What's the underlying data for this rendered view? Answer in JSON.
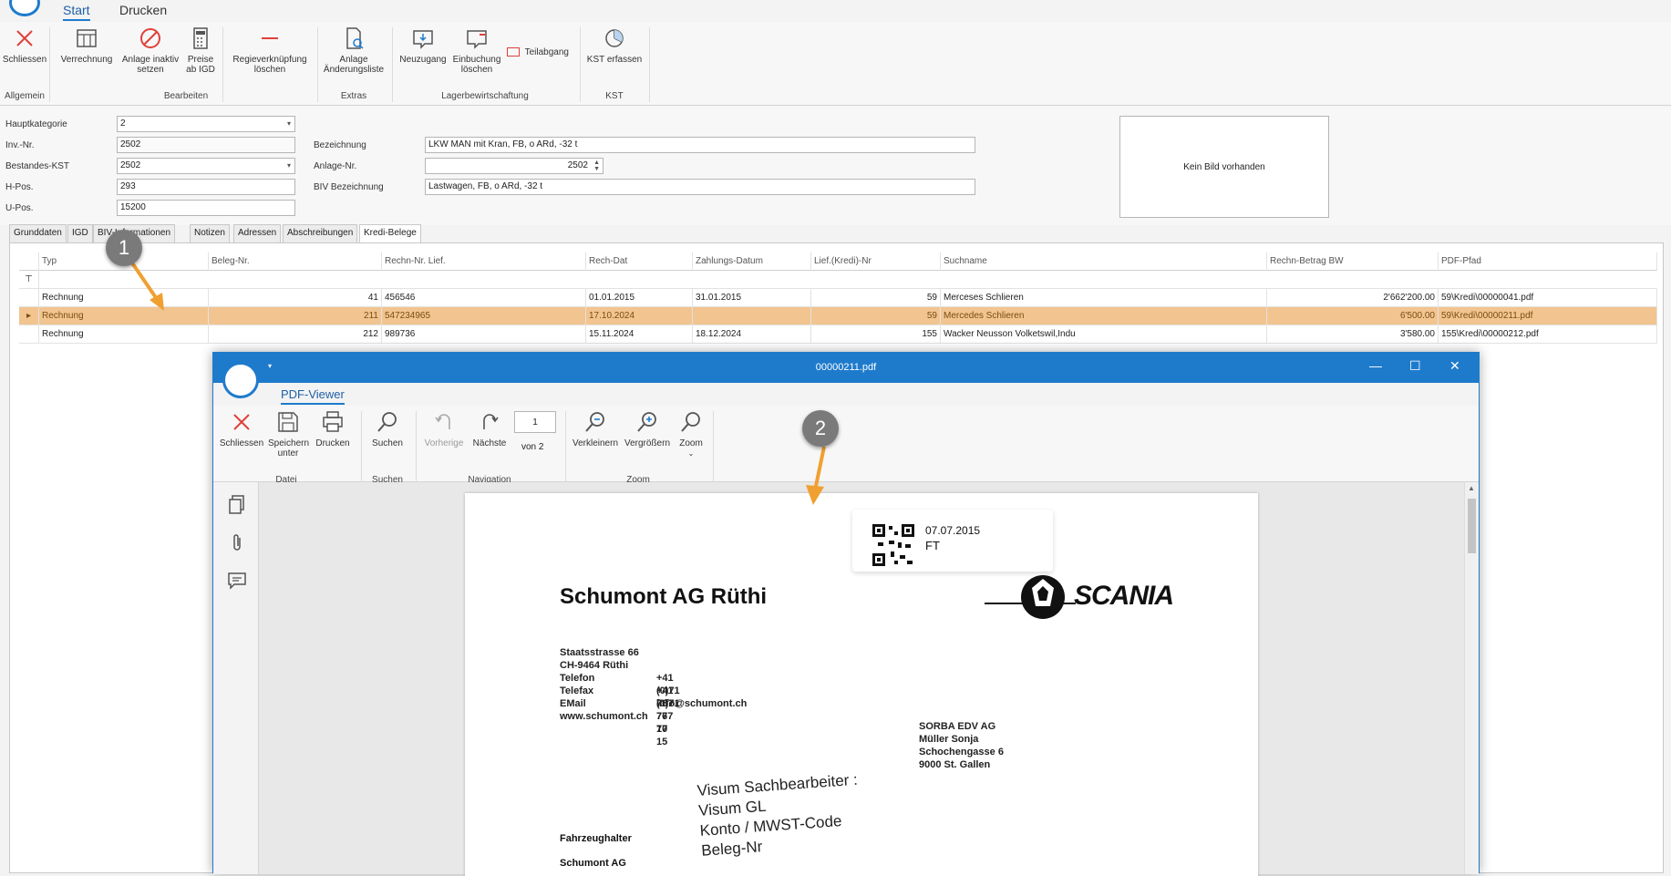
{
  "ribbon": {
    "tabs": [
      "Start",
      "Drucken"
    ],
    "buttons": {
      "schliessen": "Schliessen",
      "verrechnung": "Verrechnung",
      "anlage_inaktiv": "Anlage inaktiv setzen",
      "preise_igd": "Preise ab IGD",
      "regie_loeschen": "Regieverknüpfung löschen",
      "aenderungsliste": "Anlage Änderungsliste",
      "neuzugang": "Neuzugang",
      "einbuchung_loeschen": "Einbuchung löschen",
      "teilabgang": "Teilabgang",
      "kst_erfassen": "KST erfassen"
    },
    "groups": [
      "Allgemein",
      "Bearbeiten",
      "Extras",
      "Lagerbewirtschaftung",
      "KST"
    ],
    "accent": "#1e7bcc"
  },
  "form": {
    "hauptkategorie": {
      "label": "Hauptkategorie",
      "value": "2"
    },
    "inv_nr": {
      "label": "Inv.-Nr.",
      "value": "2502"
    },
    "bestandes_kst": {
      "label": "Bestandes-KST",
      "value": "2502"
    },
    "h_pos": {
      "label": "H-Pos.",
      "value": "293"
    },
    "u_pos": {
      "label": "U-Pos.",
      "value": "15200"
    },
    "bezeichnung": {
      "label": "Bezeichnung",
      "value": "LKW MAN mit Kran, FB, o ARd, -32 t"
    },
    "anlage_nr": {
      "label": "Anlage-Nr.",
      "value": "2502"
    },
    "biv_bezeichnung": {
      "label": "BIV Bezeichnung",
      "value": "Lastwagen, FB, o ARd, -32 t"
    },
    "no_picture": "Kein Bild vorhanden"
  },
  "detail_tabs": [
    "Grunddaten",
    "IGD",
    "BIV-Informationen",
    "Notizen",
    "Adressen",
    "Abschreibungen",
    "Kredi-Belege"
  ],
  "grid": {
    "columns": [
      "Typ",
      "Beleg-Nr.",
      "Rechn-Nr. Lief.",
      "Rech-Dat",
      "Zahlungs-Datum",
      "Lief.(Kredi)-Nr",
      "Suchname",
      "Rechn-Betrag BW",
      "PDF-Pfad"
    ],
    "rows": [
      [
        "Rechnung",
        "41",
        "456546",
        "01.01.2015",
        "31.01.2015",
        "59",
        "Merceses Schlieren",
        "2'662'200.00",
        "59\\Kredi\\00000041.pdf"
      ],
      [
        "Rechnung",
        "211",
        "547234965",
        "17.10.2024",
        "",
        "59",
        "Mercedes Schlieren",
        "6'500.00",
        "59\\Kredi\\00000211.pdf"
      ],
      [
        "Rechnung",
        "212",
        "989736",
        "15.11.2024",
        "18.12.2024",
        "155",
        "Wacker Neusson Volketswil,Indu",
        "3'580.00",
        "155\\Kredi\\00000212.pdf"
      ]
    ],
    "selected_color": "#f2c48f"
  },
  "callouts": [
    "1",
    "2"
  ],
  "pdf_viewer": {
    "title": "00000211.pdf",
    "tab": "PDF-Viewer",
    "buttons": {
      "schliessen": "Schliessen",
      "speichern": "Speichern unter",
      "drucken": "Drucken",
      "suchen": "Suchen",
      "vorherige": "Vorherige",
      "naechste": "Nächste",
      "page_value": "1",
      "page_of": "von 2",
      "verkleinern": "Verkleinern",
      "vergroessern": "Vergrößern",
      "zoom": "Zoom"
    },
    "groups": [
      "Datei",
      "Suchen",
      "Navigation",
      "Zoom"
    ],
    "document": {
      "stamp_date": "07.07.2015",
      "stamp_code": "FT",
      "company": "Schumont AG Rüthi",
      "brand": "SCANIA",
      "address": [
        "Staatsstrasse 66",
        "CH-9464 Rüthi"
      ],
      "contacts": [
        {
          "label": "Telefon",
          "value": "+41 (0)71 767 77 10"
        },
        {
          "label": "Telefax",
          "value": "+41 (0)71 767 77 15"
        },
        {
          "label": "EMail",
          "value": "info@schumont.ch"
        }
      ],
      "web": "www.schumont.ch",
      "recipient": [
        "SORBA EDV AG",
        "Müller Sonja",
        "Schochengasse 6",
        "9000 St. Gallen"
      ],
      "stamp_fields": [
        "Visum Sachbearbeiter :",
        "Visum GL",
        "Konto / MWST-Code",
        "Beleg-Nr"
      ],
      "fahrzeughalter_label": "Fahrzeughalter",
      "fahrzeughalter_value": "Schumont AG"
    }
  }
}
